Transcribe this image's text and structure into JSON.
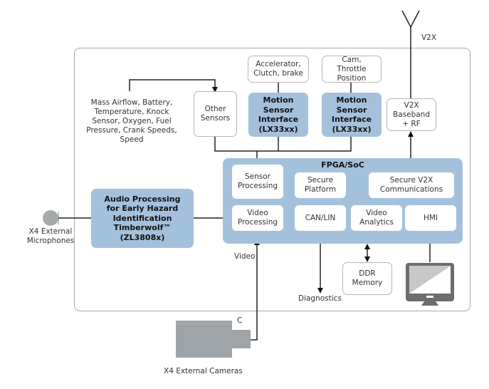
{
  "diagram": {
    "antenna_label": "V2X",
    "sensor_list_label": [
      "Mass Airflow, Battery,",
      "Temperature, Knock",
      "Sensor, Oxygen, Fuel",
      "Pressure, Crank Speeds,",
      "Speed"
    ],
    "other_sensors": "Other Sensors",
    "accelerator_box": "Accelerator, Clutch, brake",
    "cam_box": "Cam, Throttle Position",
    "motion_sensor_1": "Motion Sensor Interface (LX33xx)",
    "motion_sensor_2": "Motion Sensor Interface (LX33xx)",
    "v2x_baseband": "V2X Baseband + RF",
    "fpga": {
      "title": "FPGA/SoC",
      "blocks": {
        "sensor_processing": "Sensor Processing",
        "secure_platform": "Secure Platform",
        "secure_v2x": "Secure V2X Communications",
        "video_processing": "Video Processing",
        "can_lin": "CAN/LIN",
        "video_analytics": "Video Analytics",
        "hmi": "HMI"
      }
    },
    "audio_block": "Audio Processing for Early Hazard Identification Timberwolf™ (ZL3808x)",
    "microphones_label": "X4 External Microphones",
    "video_label": "Video",
    "diagnostics_label": "Diagnostics",
    "ddr_memory": "DDR Memory",
    "camera_letter": "C",
    "cameras_label": "X4 External Cameras",
    "icons": [
      "antenna-icon",
      "microphone-icon",
      "camera-icon",
      "monitor-icon"
    ],
    "colors": {
      "blue_block": "#a4c1dc",
      "gray_device": "#9ea4a8",
      "monitor": "#6d6d6d",
      "line": "#222222",
      "border": "#aaaaaa"
    }
  }
}
